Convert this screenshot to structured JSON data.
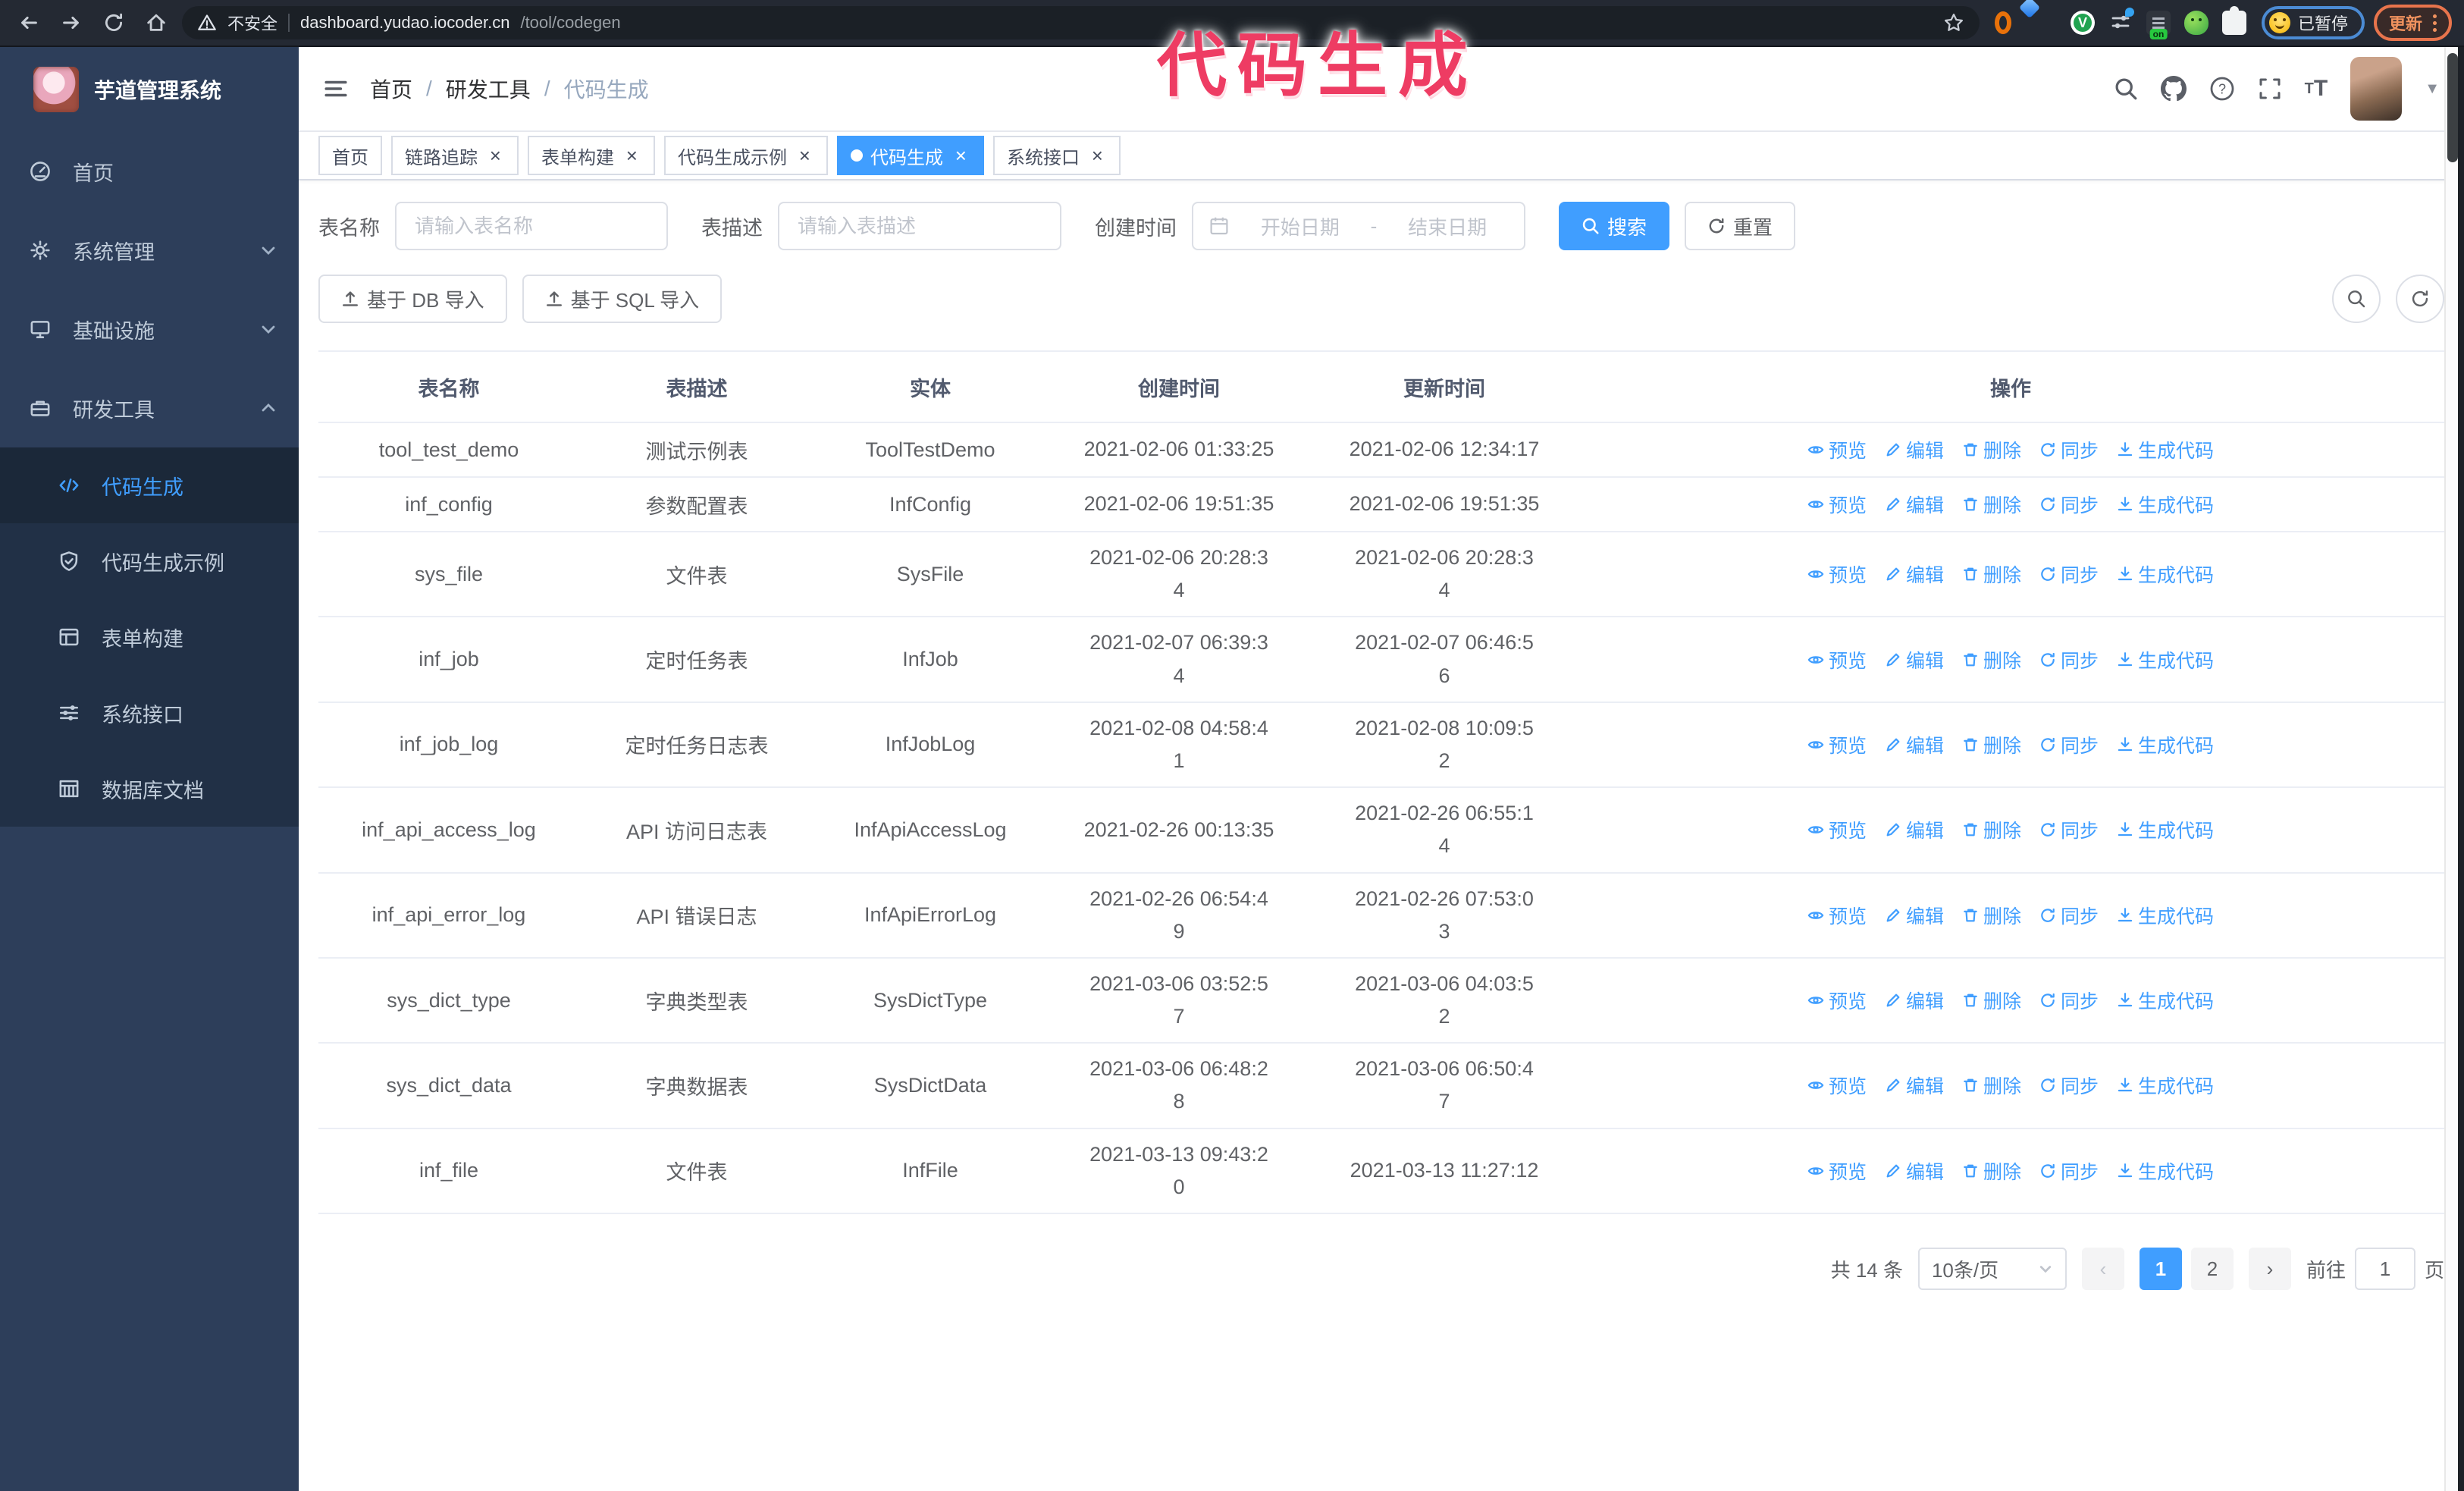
{
  "browser": {
    "security_label": "不安全",
    "url_host": "dashboard.yudao.iocoder.cn",
    "url_path": "/tool/codegen",
    "paused_badge": "已暂停",
    "update_button": "更新",
    "extensions": [
      "orange-ring-extension",
      "blue-gem-extension",
      "green-v-extension",
      "sliders-extension",
      "on-badge-extension",
      "green-creature-extension",
      "puzzle-extension"
    ]
  },
  "annotation": {
    "text": "代码生成",
    "color": "#ee3c63"
  },
  "sidebar": {
    "title": "芋道管理系统",
    "items": [
      {
        "label": "首页",
        "icon": "dashboard-icon",
        "expandable": false
      },
      {
        "label": "系统管理",
        "icon": "gear-icon",
        "expandable": true,
        "expanded": false
      },
      {
        "label": "基础设施",
        "icon": "monitor-icon",
        "expandable": true,
        "expanded": false
      },
      {
        "label": "研发工具",
        "icon": "toolbox-icon",
        "expandable": true,
        "expanded": true
      }
    ],
    "subitems": [
      {
        "label": "代码生成",
        "icon": "code-icon",
        "active": true
      },
      {
        "label": "代码生成示例",
        "icon": "shield-check-icon",
        "active": false
      },
      {
        "label": "表单构建",
        "icon": "form-icon",
        "active": false
      },
      {
        "label": "系统接口",
        "icon": "sliders-icon",
        "active": false
      },
      {
        "label": "数据库文档",
        "icon": "db-grid-icon",
        "active": false
      }
    ]
  },
  "breadcrumb": [
    "首页",
    "研发工具",
    "代码生成"
  ],
  "tabs": [
    {
      "label": "首页",
      "closable": false,
      "active": false
    },
    {
      "label": "链路追踪",
      "closable": true,
      "active": false
    },
    {
      "label": "表单构建",
      "closable": true,
      "active": false
    },
    {
      "label": "代码生成示例",
      "closable": true,
      "active": false
    },
    {
      "label": "代码生成",
      "closable": true,
      "active": true
    },
    {
      "label": "系统接口",
      "closable": true,
      "active": false
    }
  ],
  "search": {
    "name_label": "表名称",
    "name_placeholder": "请输入表名称",
    "desc_label": "表描述",
    "desc_placeholder": "请输入表描述",
    "time_label": "创建时间",
    "start_placeholder": "开始日期",
    "range_separator": "-",
    "end_placeholder": "结束日期",
    "search_label": "搜索",
    "reset_label": "重置"
  },
  "toolbar": {
    "db_import_label": "基于 DB 导入",
    "sql_import_label": "基于 SQL 导入"
  },
  "table": {
    "columns": [
      "表名称",
      "表描述",
      "实体",
      "创建时间",
      "更新时间",
      "操作"
    ],
    "action_labels": [
      "预览",
      "编辑",
      "删除",
      "同步",
      "生成代码"
    ],
    "rows": [
      {
        "name": "tool_test_demo",
        "desc": "测试示例表",
        "entity": "ToolTestDemo",
        "created": "2021-02-06 01:33:25",
        "updated": "2021-02-06 12:34:17",
        "tall": false
      },
      {
        "name": "inf_config",
        "desc": "参数配置表",
        "entity": "InfConfig",
        "created": "2021-02-06 19:51:35",
        "updated": "2021-02-06 19:51:35",
        "tall": false
      },
      {
        "name": "sys_file",
        "desc": "文件表",
        "entity": "SysFile",
        "created": "2021-02-06 20:28:3\n4",
        "updated": "2021-02-06 20:28:3\n4",
        "tall": true
      },
      {
        "name": "inf_job",
        "desc": "定时任务表",
        "entity": "InfJob",
        "created": "2021-02-07 06:39:3\n4",
        "updated": "2021-02-07 06:46:5\n6",
        "tall": true
      },
      {
        "name": "inf_job_log",
        "desc": "定时任务日志表",
        "entity": "InfJobLog",
        "created": "2021-02-08 04:58:4\n1",
        "updated": "2021-02-08 10:09:5\n2",
        "tall": true
      },
      {
        "name": "inf_api_access_log",
        "desc": "API 访问日志表",
        "entity": "InfApiAccessLog",
        "created": "2021-02-26 00:13:35",
        "updated": "2021-02-26 06:55:1\n4",
        "tall": true
      },
      {
        "name": "inf_api_error_log",
        "desc": "API 错误日志",
        "entity": "InfApiErrorLog",
        "created": "2021-02-26 06:54:4\n9",
        "updated": "2021-02-26 07:53:0\n3",
        "tall": true
      },
      {
        "name": "sys_dict_type",
        "desc": "字典类型表",
        "entity": "SysDictType",
        "created": "2021-03-06 03:52:5\n7",
        "updated": "2021-03-06 04:03:5\n2",
        "tall": true
      },
      {
        "name": "sys_dict_data",
        "desc": "字典数据表",
        "entity": "SysDictData",
        "created": "2021-03-06 06:48:2\n8",
        "updated": "2021-03-06 06:50:4\n7",
        "tall": true
      },
      {
        "name": "inf_file",
        "desc": "文件表",
        "entity": "InfFile",
        "created": "2021-03-13 09:43:2\n0",
        "updated": "2021-03-13 11:27:12",
        "tall": true
      }
    ]
  },
  "pagination": {
    "total": "共 14 条",
    "page_size": "10条/页",
    "pages": [
      "1",
      "2"
    ],
    "active_page": "1",
    "goto_label": "前往",
    "goto_value": "1",
    "page_suffix": "页"
  },
  "colors": {
    "accent": "#409eff",
    "sidebar_bg": "#2d3e5a",
    "annotation": "#ee3c63"
  }
}
